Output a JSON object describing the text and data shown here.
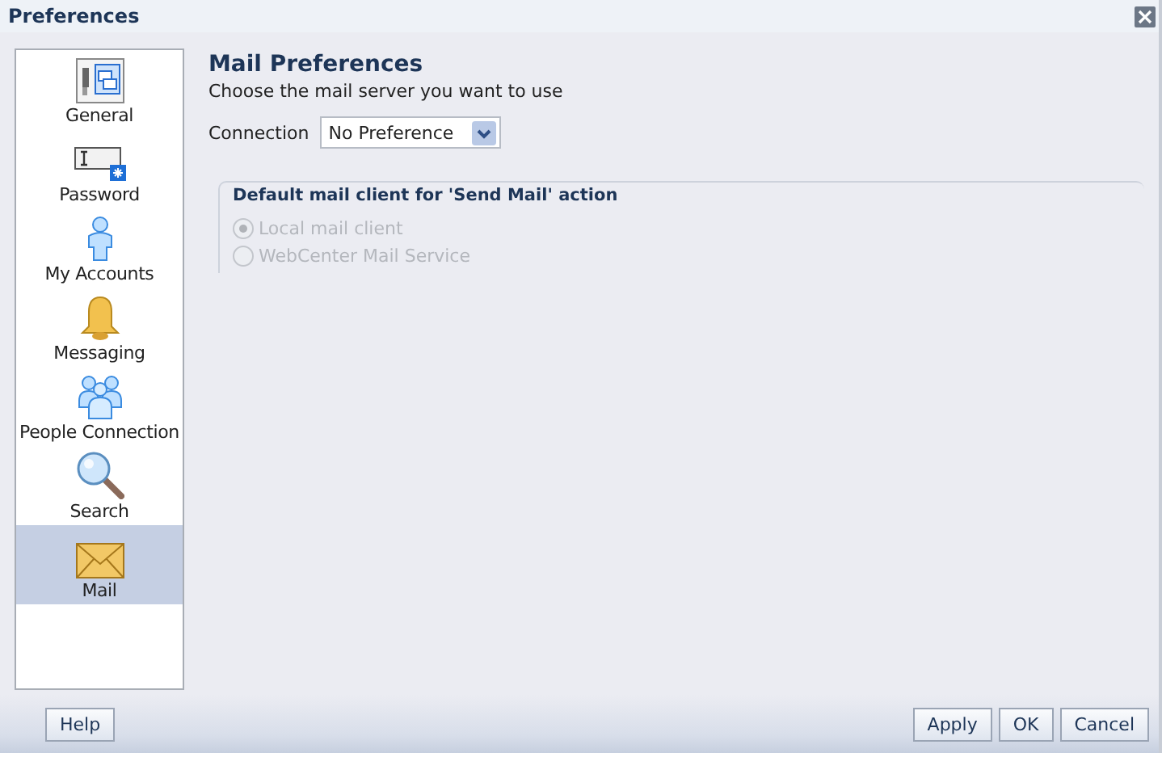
{
  "window": {
    "title": "Preferences"
  },
  "sidebar": {
    "items": [
      {
        "label": "General",
        "selected": false
      },
      {
        "label": "Password",
        "selected": false
      },
      {
        "label": "My Accounts",
        "selected": false
      },
      {
        "label": "Messaging",
        "selected": false
      },
      {
        "label": "People Connection",
        "selected": false
      },
      {
        "label": "Search",
        "selected": false
      },
      {
        "label": "Mail",
        "selected": true
      }
    ]
  },
  "content": {
    "heading": "Mail Preferences",
    "description": "Choose the mail server you want to use",
    "connection": {
      "label": "Connection",
      "value": "No Preference"
    },
    "group": {
      "title": "Default mail client for 'Send Mail' action",
      "disabled": true,
      "options": [
        {
          "label": "Local mail client",
          "selected": true
        },
        {
          "label": "WebCenter Mail Service",
          "selected": false
        }
      ]
    }
  },
  "buttons": {
    "left": [
      "Help"
    ],
    "right": [
      "Apply",
      "OK",
      "Cancel"
    ]
  }
}
